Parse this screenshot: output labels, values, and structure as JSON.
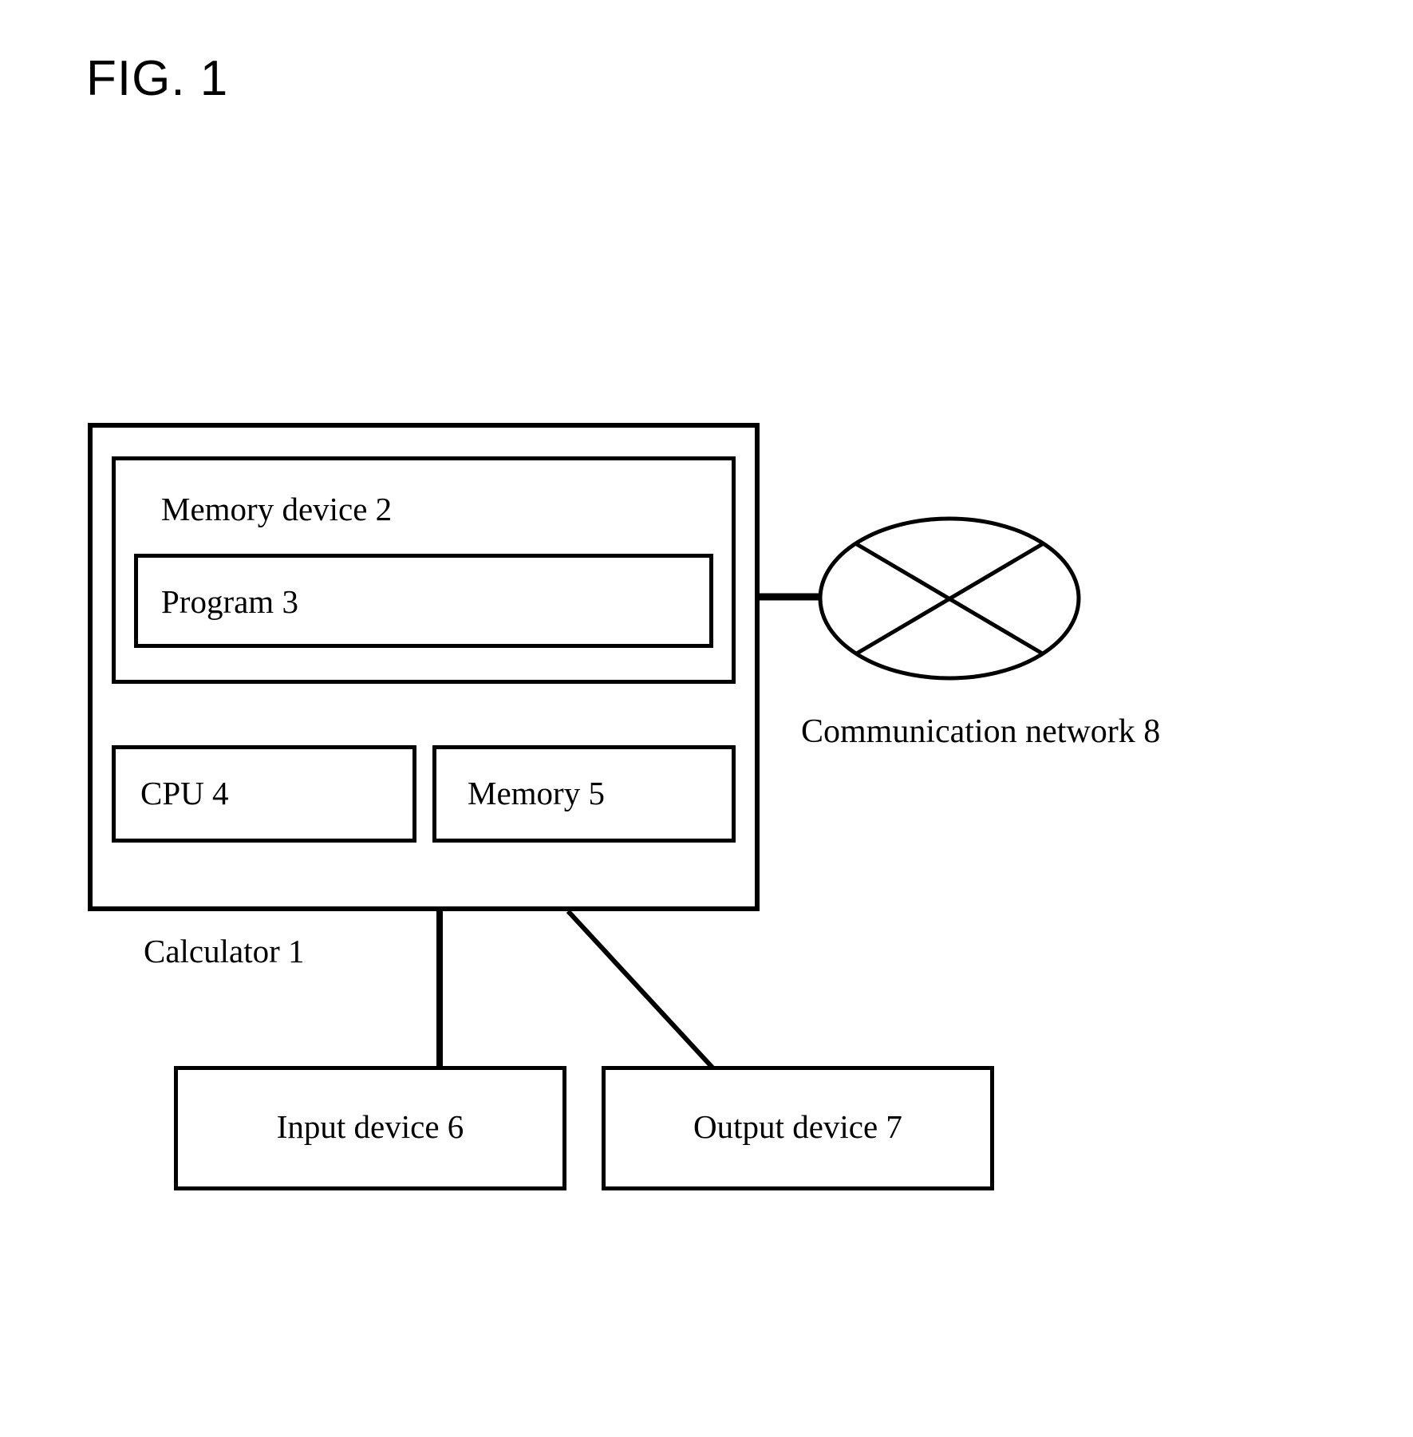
{
  "figure": {
    "title": "FIG. 1",
    "type": "block-diagram",
    "background_color": "#ffffff",
    "line_color": "#000000"
  },
  "blocks": {
    "calculator": {
      "label": "Calculator 1",
      "reference_numeral": "1",
      "label_position": "below-left-outside"
    },
    "memory_device": {
      "label": "Memory device 2",
      "reference_numeral": "2"
    },
    "program": {
      "label": "Program 3",
      "reference_numeral": "3"
    },
    "cpu": {
      "label": "CPU 4",
      "reference_numeral": "4"
    },
    "memory": {
      "label": "Memory 5",
      "reference_numeral": "5"
    },
    "input_device": {
      "label": "Input device 6",
      "reference_numeral": "6"
    },
    "output_device": {
      "label": "Output device 7",
      "reference_numeral": "7"
    },
    "communication_network": {
      "label": "Communication network 8",
      "reference_numeral": "8",
      "shape": "ellipse-with-cross"
    }
  },
  "connections": [
    {
      "from": "calculator",
      "to": "communication_network",
      "style": "solid-horizontal"
    },
    {
      "from": "calculator",
      "to": "input_device",
      "style": "solid-vertical"
    },
    {
      "from": "calculator",
      "to": "output_device",
      "style": "solid-diagonal"
    }
  ]
}
